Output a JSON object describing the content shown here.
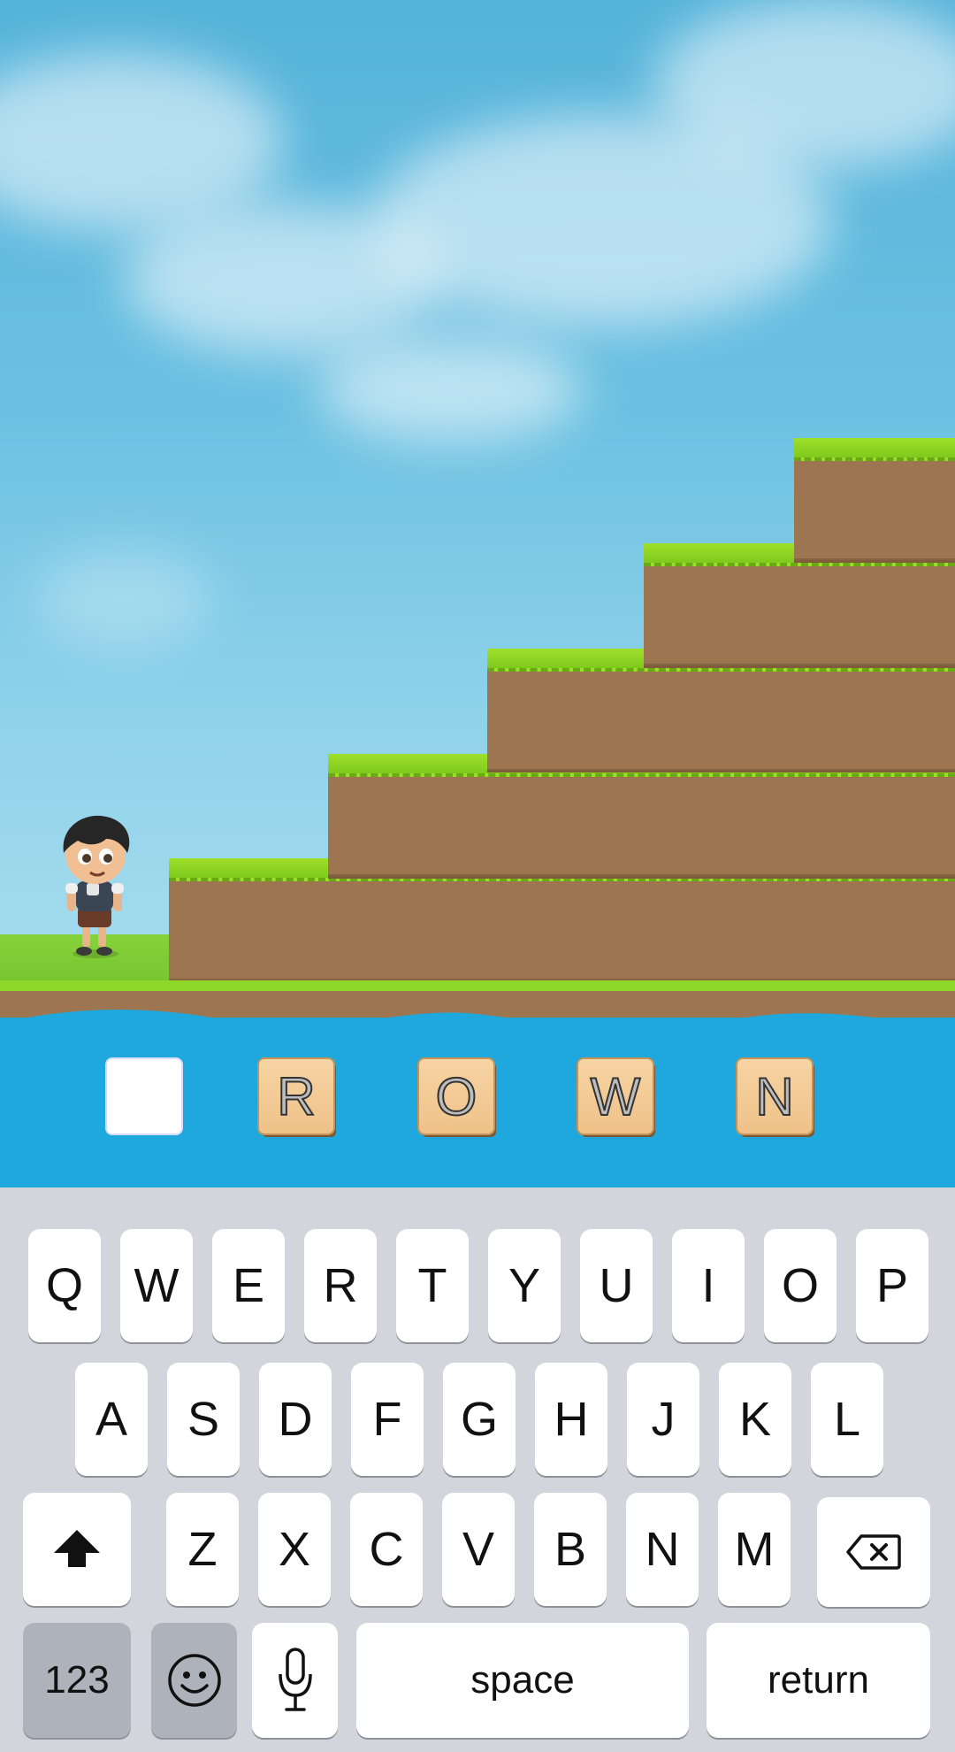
{
  "puzzle": {
    "tiles": [
      "",
      "R",
      "O",
      "W",
      "N"
    ],
    "active_index": 0
  },
  "keyboard": {
    "row1": [
      "Q",
      "W",
      "E",
      "R",
      "T",
      "Y",
      "U",
      "I",
      "O",
      "P"
    ],
    "row2": [
      "A",
      "S",
      "D",
      "F",
      "G",
      "H",
      "J",
      "K",
      "L"
    ],
    "row3": [
      "Z",
      "X",
      "C",
      "V",
      "B",
      "N",
      "M"
    ],
    "numbers_label": "123",
    "space_label": "space",
    "return_label": "return",
    "shift_icon": "shift-arrow-icon",
    "backspace_icon": "backspace-icon",
    "emoji_icon": "smiley-icon",
    "mic_icon": "microphone-icon"
  },
  "colors": {
    "sky": "#55b3da",
    "grass": "#8fd32a",
    "dirt": "#9d7651",
    "water": "#1fa8dd",
    "keyboard_bg": "#d2d5db"
  }
}
